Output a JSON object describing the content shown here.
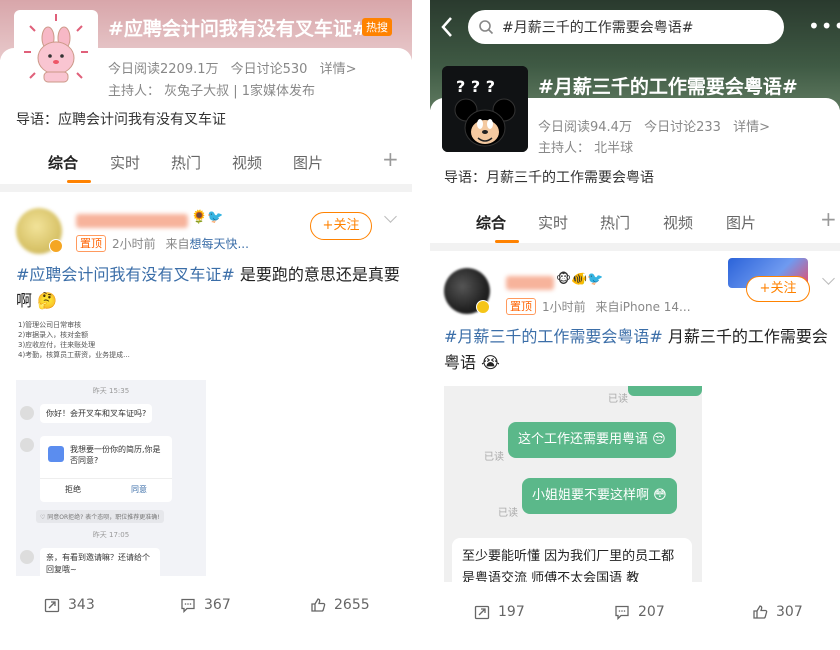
{
  "left": {
    "topic_title": "#应聘会计问我有没有叉车证#",
    "hot_badge": "热搜",
    "stats": {
      "reads": "今日阅读2209.1万",
      "discussions": "今日讨论530",
      "details": "详情>"
    },
    "host": "主持人：  灰兔子大叔 | 1家媒体发布",
    "lead": "导语：应聘会计问我有没有叉车证",
    "tabs": [
      "综合",
      "实时",
      "热门",
      "视频",
      "图片"
    ],
    "post": {
      "pin_label": "置顶",
      "time": "2小时前",
      "source_prefix": "来自",
      "source": "想每天快...",
      "follow_label": "+关注",
      "hashtag": "#应聘会计问我有没有叉车证#",
      "text": " 是要跑的意思还是真要啊",
      "screenshot": {
        "duties": [
          "1)管理公司日常审核",
          "2)审据录入，核对金额",
          "3)应收应付，往来账处理",
          "4)考勤，核算员工薪资，业务提成..."
        ],
        "time1": "昨天 15:35",
        "msg1": "你好！会开叉车和叉车证吗?",
        "msg2": "我想要一份你的简历,你是否同意?",
        "reject": "拒绝",
        "agree": "同意",
        "system": "♡ 同意OR拒绝? 表个态呗，职位推荐更准确!",
        "time2": "昨天 17:05",
        "msg3": "亲，有看到邀请嘛？还请给个回复哦~"
      },
      "counts": {
        "reposts": "343",
        "comments": "367",
        "likes": "2655"
      }
    }
  },
  "right": {
    "search_text": "#月薪三千的工作需要会粤语#",
    "topic_title": "#月薪三千的工作需要会粤语#",
    "stats": {
      "reads": "今日阅读94.4万",
      "discussions": "今日讨论233",
      "details": "详情>"
    },
    "host": "主持人：  北半球",
    "lead": "导语：月薪三千的工作需要会粤语",
    "tabs": [
      "综合",
      "实时",
      "热门",
      "视频",
      "图片"
    ],
    "post": {
      "pin_label": "置顶",
      "time": "1小时前",
      "source": "来自iPhone 14...",
      "follow_label": "+关注",
      "hashtag": "#月薪三千的工作需要会粤语#",
      "text": " 月薪三千的工作需要会粤语",
      "screenshot": {
        "read_label": "已读",
        "msg1": "这个工作还需要用粤语",
        "msg2": "小姐姐要不要这样啊",
        "msg3": "至少要能听懂 因为我们厂里的员工都是粤语交流 师傅不太会国语 教"
      },
      "counts": {
        "reposts": "197",
        "comments": "207",
        "likes": "307"
      }
    }
  },
  "colors": {
    "accent": "#ff8200",
    "link": "#3b6ea8",
    "chat_green": "#5bb88a"
  }
}
